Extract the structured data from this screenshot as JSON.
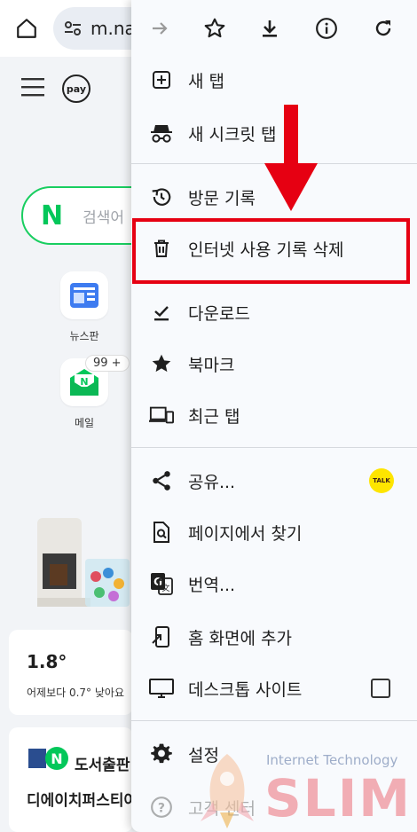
{
  "browser": {
    "url_text": "m.na"
  },
  "page": {
    "pay_label": "pay",
    "search_logo": "N",
    "search_placeholder": "검색어",
    "apps": [
      {
        "label": "뉴스판",
        "icon": "news-icon"
      },
      {
        "label": "메일",
        "icon": "mail-icon",
        "badge": "99 +"
      }
    ],
    "weather": {
      "temp": "1.8°",
      "sub": "어제보다 0.7° 낮아요"
    },
    "book": {
      "title": "도서출판",
      "subtitle": "디에이치퍼스티아"
    }
  },
  "menu": {
    "toolbar": [
      "forward-icon",
      "star-icon",
      "download-icon",
      "info-icon",
      "refresh-icon"
    ],
    "items": [
      {
        "label": "새 탭",
        "icon": "new-tab-icon"
      },
      {
        "label": "새 시크릿 탭",
        "icon": "incognito-icon"
      },
      {
        "label": "방문 기록",
        "icon": "history-icon"
      },
      {
        "label": "인터넷 사용 기록 삭제",
        "icon": "trash-icon"
      },
      {
        "label": "다운로드",
        "icon": "download-check-icon"
      },
      {
        "label": "북마크",
        "icon": "star-filled-icon"
      },
      {
        "label": "최근 탭",
        "icon": "devices-icon"
      },
      {
        "label": "공유...",
        "icon": "share-icon",
        "badge": "TALK"
      },
      {
        "label": "페이지에서 찾기",
        "icon": "find-in-page-icon"
      },
      {
        "label": "번역...",
        "icon": "translate-icon"
      },
      {
        "label": "홈 화면에 추가",
        "icon": "add-to-home-icon"
      },
      {
        "label": "데스크톱 사이트",
        "icon": "desktop-icon",
        "checked": false
      },
      {
        "label": "설정",
        "icon": "settings-icon"
      },
      {
        "label": "고객 센터",
        "icon": "help-icon"
      }
    ]
  },
  "annotation": {
    "highlight_color": "#e60012",
    "arrow_color": "#e60012"
  },
  "watermark": {
    "line1": "Internet Technology",
    "line2": "SLIM"
  }
}
